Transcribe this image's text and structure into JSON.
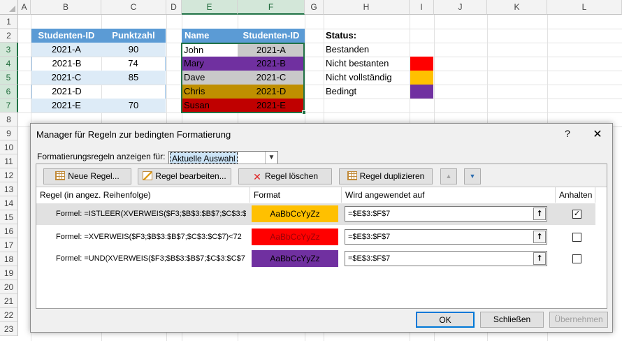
{
  "columns": [
    "A",
    "B",
    "C",
    "D",
    "E",
    "F",
    "G",
    "H",
    "I",
    "J",
    "K",
    "L"
  ],
  "rows": [
    "1",
    "2",
    "3",
    "4",
    "5",
    "6",
    "7",
    "8",
    "9",
    "10",
    "11",
    "12",
    "13",
    "14",
    "15",
    "16",
    "17",
    "18",
    "19",
    "20",
    "21",
    "22",
    "23"
  ],
  "table1": {
    "headers": [
      "Studenten-ID",
      "Punktzahl"
    ],
    "rows": [
      [
        "2021-A",
        "90"
      ],
      [
        "2021-B",
        "74"
      ],
      [
        "2021-C",
        "85"
      ],
      [
        "2021-D",
        ""
      ],
      [
        "2021-E",
        "70"
      ]
    ]
  },
  "table2": {
    "headers": [
      "Name",
      "Studenten-ID"
    ],
    "rows": [
      {
        "name": "John",
        "id": "2021-A",
        "color": "#c9c9c9"
      },
      {
        "name": "Mary",
        "id": "2021-B",
        "color": "#7030a0"
      },
      {
        "name": "Dave",
        "id": "2021-C",
        "color": "#c9c9c9"
      },
      {
        "name": "Chris",
        "id": "2021-D",
        "color": "#bf8f00"
      },
      {
        "name": "Susan",
        "id": "2021-E",
        "color": "#c00000"
      }
    ]
  },
  "status": {
    "title": "Status:",
    "items": [
      {
        "label": "Bestanden",
        "color": ""
      },
      {
        "label": "Nicht bestanten",
        "color": "#ff0000"
      },
      {
        "label": "Nicht vollständig",
        "color": "#ffc000"
      },
      {
        "label": "Bedingt",
        "color": "#7030a0"
      }
    ]
  },
  "dialog": {
    "title": "Manager für Regeln zur bedingten Formatierung",
    "help": "?",
    "close": "✕",
    "show_label": "Formatierungsregeln anzeigen für:",
    "show_value": "Aktuelle Auswahl",
    "buttons": {
      "new": "Neue Regel...",
      "edit": "Regel bearbeiten...",
      "delete": "Regel löschen",
      "duplicate": "Regel duplizieren",
      "up": "▲",
      "down": "▼"
    },
    "columns": {
      "rule": "Regel (in angez. Reihenfolge)",
      "format": "Format",
      "applies": "Wird angewendet auf",
      "stop": "Anhalten"
    },
    "rules": [
      {
        "formula": "Formel: =ISTLEER(XVERWEIS($F3;$B$3:$B$7;$C$3:$...",
        "preview": "AaBbCcYyZz",
        "bg": "#ffc000",
        "applies": "=$E$3:$F$7",
        "stop": true
      },
      {
        "formula": "Formel: =XVERWEIS($F3;$B$3:$B$7;$C$3:$C$7)<72",
        "preview": "AaBbCcYyZz",
        "bg": "#ff0000",
        "applies": "=$E$3:$F$7",
        "stop": false
      },
      {
        "formula": "Formel: =UND(XVERWEIS($F3;$B$3:$B$7;$C$3:$C$7...",
        "preview": "AaBbCcYyZz",
        "bg": "#7030a0",
        "applies": "=$E$3:$F$7",
        "stop": false
      }
    ],
    "collapse_icon": "⭡",
    "ok": "OK",
    "close_btn": "Schließen",
    "apply": "Übernehmen"
  }
}
